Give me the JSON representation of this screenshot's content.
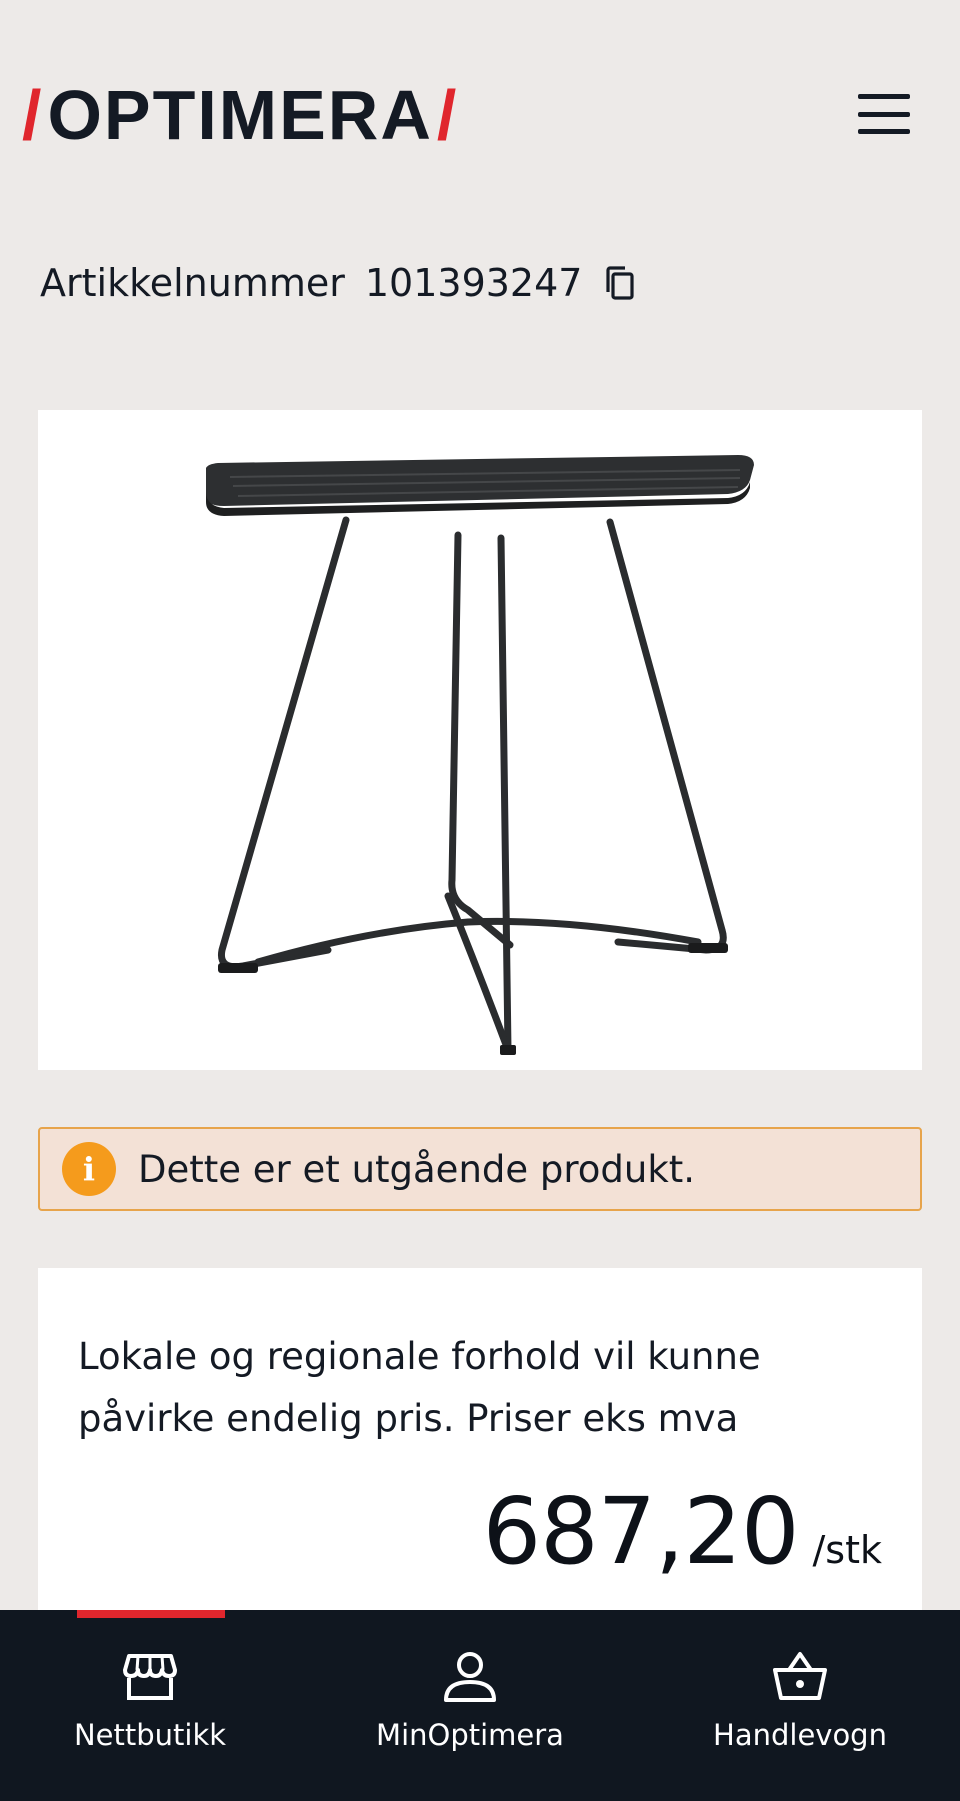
{
  "header": {
    "logo": "OPTIMERA",
    "brand_color": "#e0262d",
    "menu_icon": "hamburger-menu-icon"
  },
  "article": {
    "label": "Artikkelnummer",
    "number": "101393247",
    "copy_icon": "copy-icon"
  },
  "product": {
    "image": "black metal bistro table with slatted square top and crossed legs"
  },
  "notice": {
    "icon": "info-icon",
    "icon_glyph": "i",
    "text": "Dette er et utgående produkt.",
    "accent_color": "#f59b1c"
  },
  "price": {
    "description": "Lokale og regionale forhold vil kunne påvirke endelig pris. Priser eks mva",
    "amount": "687,20",
    "unit": "/stk"
  },
  "bottom_nav": {
    "items": [
      {
        "label": "Nettbutikk",
        "icon": "store-icon",
        "active": true
      },
      {
        "label": "MinOptimera",
        "icon": "user-icon",
        "active": false
      },
      {
        "label": "Handlevogn",
        "icon": "basket-icon",
        "active": false
      }
    ]
  }
}
